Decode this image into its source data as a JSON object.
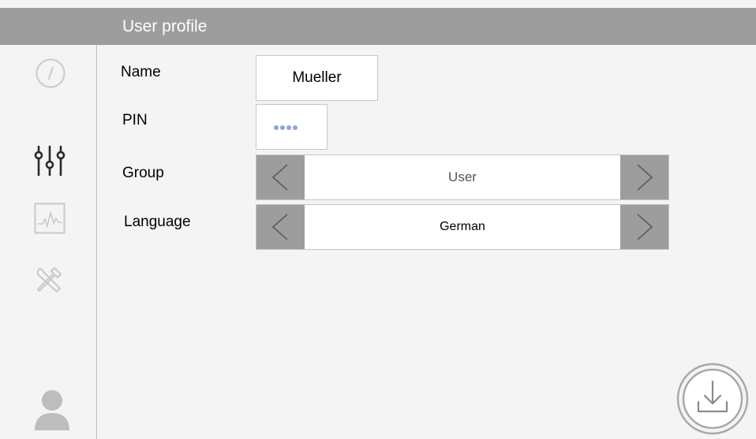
{
  "header": {
    "title": "User profile"
  },
  "sidebar": {
    "items": [
      {
        "name": "dashboard",
        "icon": "gauge-icon"
      },
      {
        "name": "settings",
        "icon": "sliders-icon"
      },
      {
        "name": "monitoring",
        "icon": "chart-icon"
      },
      {
        "name": "service",
        "icon": "tools-icon"
      },
      {
        "name": "user",
        "icon": "user-icon"
      }
    ]
  },
  "form": {
    "name": {
      "label": "Name",
      "value": "Mueller"
    },
    "pin": {
      "label": "PIN",
      "mask_length": 4
    },
    "group": {
      "label": "Group",
      "value": "User"
    },
    "language": {
      "label": "Language",
      "value": "German"
    }
  },
  "actions": {
    "save": {
      "icon": "download-icon"
    }
  },
  "colors": {
    "header_bg": "#9d9d9d",
    "page_bg": "#f3f4f3",
    "arrow_bg": "#9d9d9d",
    "pin_dot": "#8fa6d6"
  }
}
